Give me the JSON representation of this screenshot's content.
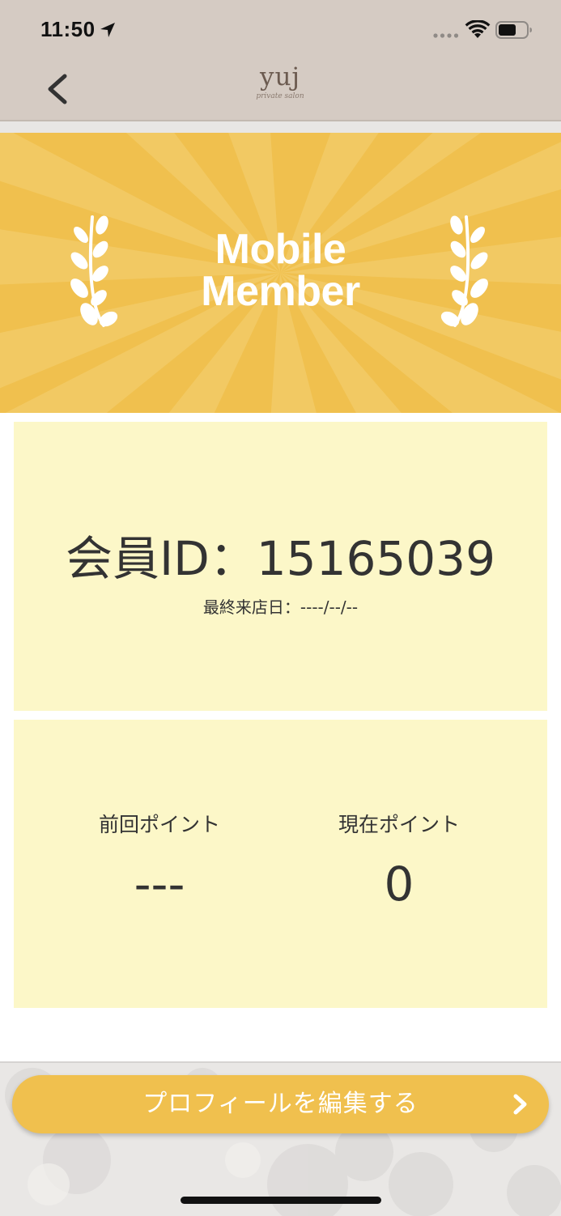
{
  "status_bar": {
    "time": "11:50"
  },
  "nav": {
    "logo_text": "yuj",
    "logo_subtext": "private salon"
  },
  "banner": {
    "title_line1": "Mobile",
    "title_line2": "Member"
  },
  "member": {
    "id_text": "会員ID：15165039",
    "last_visit_text": "最終来店日：----/--/--"
  },
  "points": {
    "previous_label": "前回ポイント",
    "previous_value": "---",
    "current_label": "現在ポイント",
    "current_value": "0"
  },
  "actions": {
    "edit_profile_label": "プロフィールを編集する"
  },
  "colors": {
    "accent": "#f0c04e",
    "card_background": "#fcf7c8",
    "nav_background": "#d5cbc3",
    "text": "#333333"
  },
  "icons": {
    "back": "chevron-left-icon",
    "location": "location-arrow-icon",
    "wifi": "wifi-icon",
    "battery": "battery-icon",
    "laurel": "laurel-icon",
    "forward": "chevron-right-icon"
  }
}
